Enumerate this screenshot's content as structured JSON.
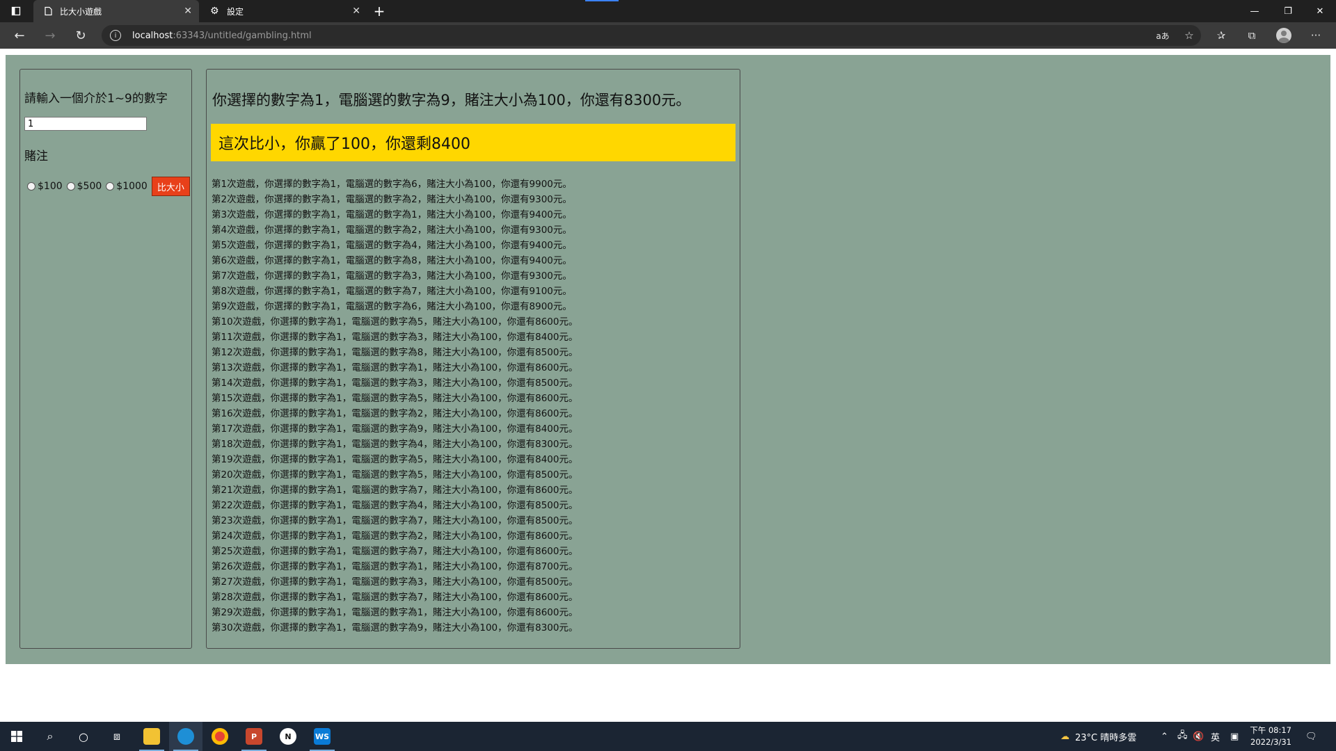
{
  "browser": {
    "tabs": [
      {
        "label": "比大小遊戲",
        "icon": "page-icon",
        "active": true
      },
      {
        "label": "設定",
        "icon": "gear-icon",
        "active": false
      }
    ],
    "address": {
      "host": "localhost",
      "path": ":63343/untitled/gambling.html"
    }
  },
  "game": {
    "prompt": "請輸入一個介於1~9的數字",
    "input_value": "1",
    "bet_label": "賭注",
    "bet_options": [
      "$100",
      "$500",
      "$1000"
    ],
    "compare_button": "比大小",
    "summary": "你選擇的數字為1，電腦選的數字為9，賭注大小為100，你還有8300元。",
    "result": "這次比小，你贏了100，你還剩8400",
    "history": [
      "第1次遊戲，你選擇的數字為1，電腦選的數字為6，賭注大小為100，你還有9900元。",
      "第2次遊戲，你選擇的數字為1，電腦選的數字為2，賭注大小為100，你還有9300元。",
      "第3次遊戲，你選擇的數字為1，電腦選的數字為1，賭注大小為100，你還有9400元。",
      "第4次遊戲，你選擇的數字為1，電腦選的數字為2，賭注大小為100，你還有9300元。",
      "第5次遊戲，你選擇的數字為1，電腦選的數字為4，賭注大小為100，你還有9400元。",
      "第6次遊戲，你選擇的數字為1，電腦選的數字為8，賭注大小為100，你還有9400元。",
      "第7次遊戲，你選擇的數字為1，電腦選的數字為3，賭注大小為100，你還有9300元。",
      "第8次遊戲，你選擇的數字為1，電腦選的數字為7，賭注大小為100，你還有9100元。",
      "第9次遊戲，你選擇的數字為1，電腦選的數字為6，賭注大小為100，你還有8900元。",
      "第10次遊戲，你選擇的數字為1，電腦選的數字為5，賭注大小為100，你還有8600元。",
      "第11次遊戲，你選擇的數字為1，電腦選的數字為3，賭注大小為100，你還有8400元。",
      "第12次遊戲，你選擇的數字為1，電腦選的數字為8，賭注大小為100，你還有8500元。",
      "第13次遊戲，你選擇的數字為1，電腦選的數字為1，賭注大小為100，你還有8600元。",
      "第14次遊戲，你選擇的數字為1，電腦選的數字為3，賭注大小為100，你還有8500元。",
      "第15次遊戲，你選擇的數字為1，電腦選的數字為5，賭注大小為100，你還有8600元。",
      "第16次遊戲，你選擇的數字為1，電腦選的數字為2，賭注大小為100，你還有8600元。",
      "第17次遊戲，你選擇的數字為1，電腦選的數字為9，賭注大小為100，你還有8400元。",
      "第18次遊戲，你選擇的數字為1，電腦選的數字為4，賭注大小為100，你還有8300元。",
      "第19次遊戲，你選擇的數字為1，電腦選的數字為5，賭注大小為100，你還有8400元。",
      "第20次遊戲，你選擇的數字為1，電腦選的數字為5，賭注大小為100，你還有8500元。",
      "第21次遊戲，你選擇的數字為1，電腦選的數字為7，賭注大小為100，你還有8600元。",
      "第22次遊戲，你選擇的數字為1，電腦選的數字為4，賭注大小為100，你還有8500元。",
      "第23次遊戲，你選擇的數字為1，電腦選的數字為7，賭注大小為100，你還有8500元。",
      "第24次遊戲，你選擇的數字為1，電腦選的數字為2，賭注大小為100，你還有8600元。",
      "第25次遊戲，你選擇的數字為1，電腦選的數字為7，賭注大小為100，你還有8600元。",
      "第26次遊戲，你選擇的數字為1，電腦選的數字為1，賭注大小為100，你還有8700元。",
      "第27次遊戲，你選擇的數字為1，電腦選的數字為3，賭注大小為100，你還有8500元。",
      "第28次遊戲，你選擇的數字為1，電腦選的數字為7，賭注大小為100，你還有8600元。",
      "第29次遊戲，你選擇的數字為1，電腦選的數字為1，賭注大小為100，你還有8600元。",
      "第30次遊戲，你選擇的數字為1，電腦選的數字為9，賭注大小為100，你還有8300元。"
    ]
  },
  "taskbar": {
    "weather": "23°C  晴時多雲",
    "ime": "英",
    "time": "下午 08:17",
    "date": "2022/3/31",
    "apps": [
      "file-explorer-icon",
      "edge-icon",
      "chrome-icon",
      "powerpoint-icon",
      "notion-icon",
      "webstorm-icon"
    ]
  },
  "colors": {
    "game_bg": "#89a394",
    "result_bg": "#ffd700",
    "button_bg": "#e8401a"
  }
}
